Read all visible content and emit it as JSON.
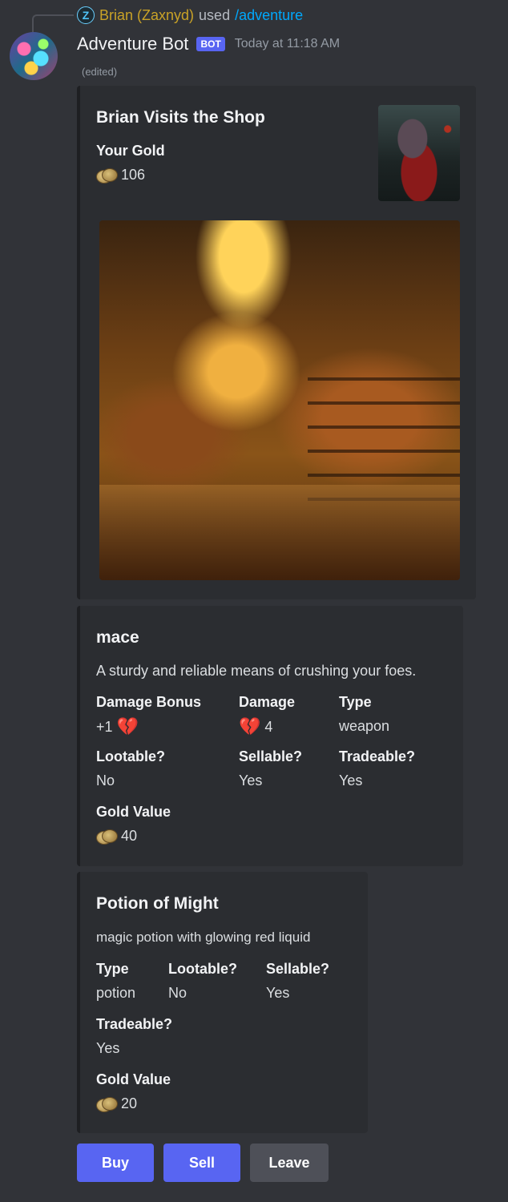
{
  "reply": {
    "user": "Brian (Zaxnyd)",
    "used": "used",
    "command": "/adventure",
    "avatar_icon": "Z"
  },
  "message": {
    "author": "Adventure Bot",
    "bot_tag": "BOT",
    "timestamp": "Today at 11:18 AM",
    "edited": "(edited)"
  },
  "shop_embed": {
    "title": "Brian Visits the Shop",
    "gold_label": "Your Gold",
    "gold_value": "106",
    "gold_icon": "coin-icon",
    "thumbnail": "plague-doctor-thumbnail",
    "image": "shop-interior-image"
  },
  "item1": {
    "title": "mace",
    "description": "A sturdy and reliable means of crushing your foes.",
    "fields": {
      "damage_bonus": {
        "name": "Damage Bonus",
        "value": "+1"
      },
      "damage": {
        "name": "Damage",
        "value": "4"
      },
      "type": {
        "name": "Type",
        "value": "weapon"
      },
      "lootable": {
        "name": "Lootable?",
        "value": "No"
      },
      "sellable": {
        "name": "Sellable?",
        "value": "Yes"
      },
      "tradeable": {
        "name": "Tradeable?",
        "value": "Yes"
      },
      "gold_value": {
        "name": "Gold Value",
        "value": "40"
      }
    },
    "heart_glyph": "💔"
  },
  "item2": {
    "title": "Potion of Might",
    "description": "magic potion with glowing red liquid",
    "fields": {
      "type": {
        "name": "Type",
        "value": "potion"
      },
      "lootable": {
        "name": "Lootable?",
        "value": "No"
      },
      "sellable": {
        "name": "Sellable?",
        "value": "Yes"
      },
      "tradeable": {
        "name": "Tradeable?",
        "value": "Yes"
      },
      "gold_value": {
        "name": "Gold Value",
        "value": "20"
      }
    }
  },
  "buttons": {
    "buy": "Buy",
    "sell": "Sell",
    "leave": "Leave"
  },
  "colors": {
    "background": "#313338",
    "embed": "#2b2d31",
    "blurple": "#5865f2",
    "secondary_button": "#4e5058",
    "reply_user": "#c9a227",
    "command_link": "#00a8fc"
  }
}
